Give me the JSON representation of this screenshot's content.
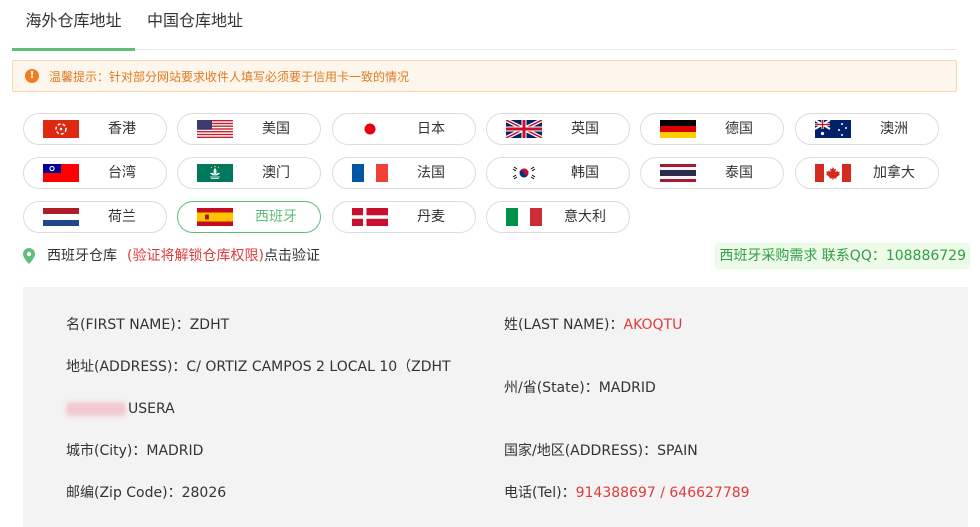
{
  "tabs": [
    {
      "label": "海外仓库地址",
      "active": true
    },
    {
      "label": "中国仓库地址",
      "active": false
    }
  ],
  "notice": {
    "icon": "exclamation-icon",
    "text": "温馨提示：针对部分网站要求收件人填写必须要于信用卡一致的情况"
  },
  "countries": [
    {
      "name": "香港",
      "flag": "hong-kong-flag"
    },
    {
      "name": "美国",
      "flag": "usa-flag"
    },
    {
      "name": "日本",
      "flag": "japan-flag"
    },
    {
      "name": "英国",
      "flag": "uk-flag"
    },
    {
      "name": "德国",
      "flag": "germany-flag"
    },
    {
      "name": "澳洲",
      "flag": "australia-flag"
    },
    {
      "name": "台湾",
      "flag": "taiwan-flag"
    },
    {
      "name": "澳门",
      "flag": "macau-flag"
    },
    {
      "name": "法国",
      "flag": "france-flag"
    },
    {
      "name": "韩国",
      "flag": "korea-flag"
    },
    {
      "name": "泰国",
      "flag": "thailand-flag"
    },
    {
      "name": "加拿大",
      "flag": "canada-flag"
    },
    {
      "name": "荷兰",
      "flag": "netherlands-flag"
    },
    {
      "name": "西班牙",
      "flag": "spain-flag",
      "active": true
    },
    {
      "name": "丹麦",
      "flag": "denmark-flag"
    },
    {
      "name": "意大利",
      "flag": "italy-flag"
    }
  ],
  "location": {
    "icon": "location-pin-icon",
    "warehouse": "西班牙仓库",
    "verify_hint": "(验证将解锁仓库权限)",
    "verify_link": "点击验证"
  },
  "contact": {
    "text": "西班牙采购需求 联系QQ：108886729"
  },
  "address": {
    "first_name_label": "名(FIRST NAME)：",
    "first_name": "ZDHT",
    "last_name_label": "姓(LAST NAME)：",
    "last_name": "AKOQTU",
    "address_label": "地址(ADDRESS)：",
    "address_line1": "C/ ORTIZ CAMPOS 2 LOCAL 10（ZDHT",
    "address_line2": "USERA",
    "state_label": "州/省(State)：",
    "state": "MADRID",
    "city_label": "城市(City)：",
    "city": "MADRID",
    "country_label": "国家/地区(ADDRESS)：",
    "country": "SPAIN",
    "zip_label": "邮编(Zip Code)：",
    "zip": "28026",
    "tel_label": "电话(Tel)：",
    "tel": "914388697 / 646627789"
  },
  "colors": {
    "accent": "#5fbe79",
    "warning": "#e07a1f",
    "danger": "#e03b3b",
    "panel": "#f3f3f3"
  }
}
